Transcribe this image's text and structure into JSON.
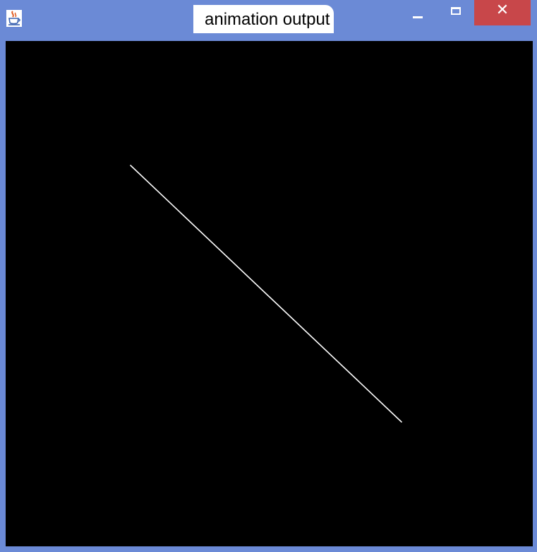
{
  "window": {
    "title": "animation output",
    "titlebar_color": "#6b8ad6",
    "close_color": "#c8474a",
    "canvas_color": "#000000",
    "line_color": "#ffffff"
  },
  "controls": {
    "app_icon": "java-coffee-icon",
    "minimize_icon": "minimize-icon",
    "maximize_icon": "maximize-icon",
    "close_icon": "close-icon",
    "close_glyph": "✕"
  }
}
